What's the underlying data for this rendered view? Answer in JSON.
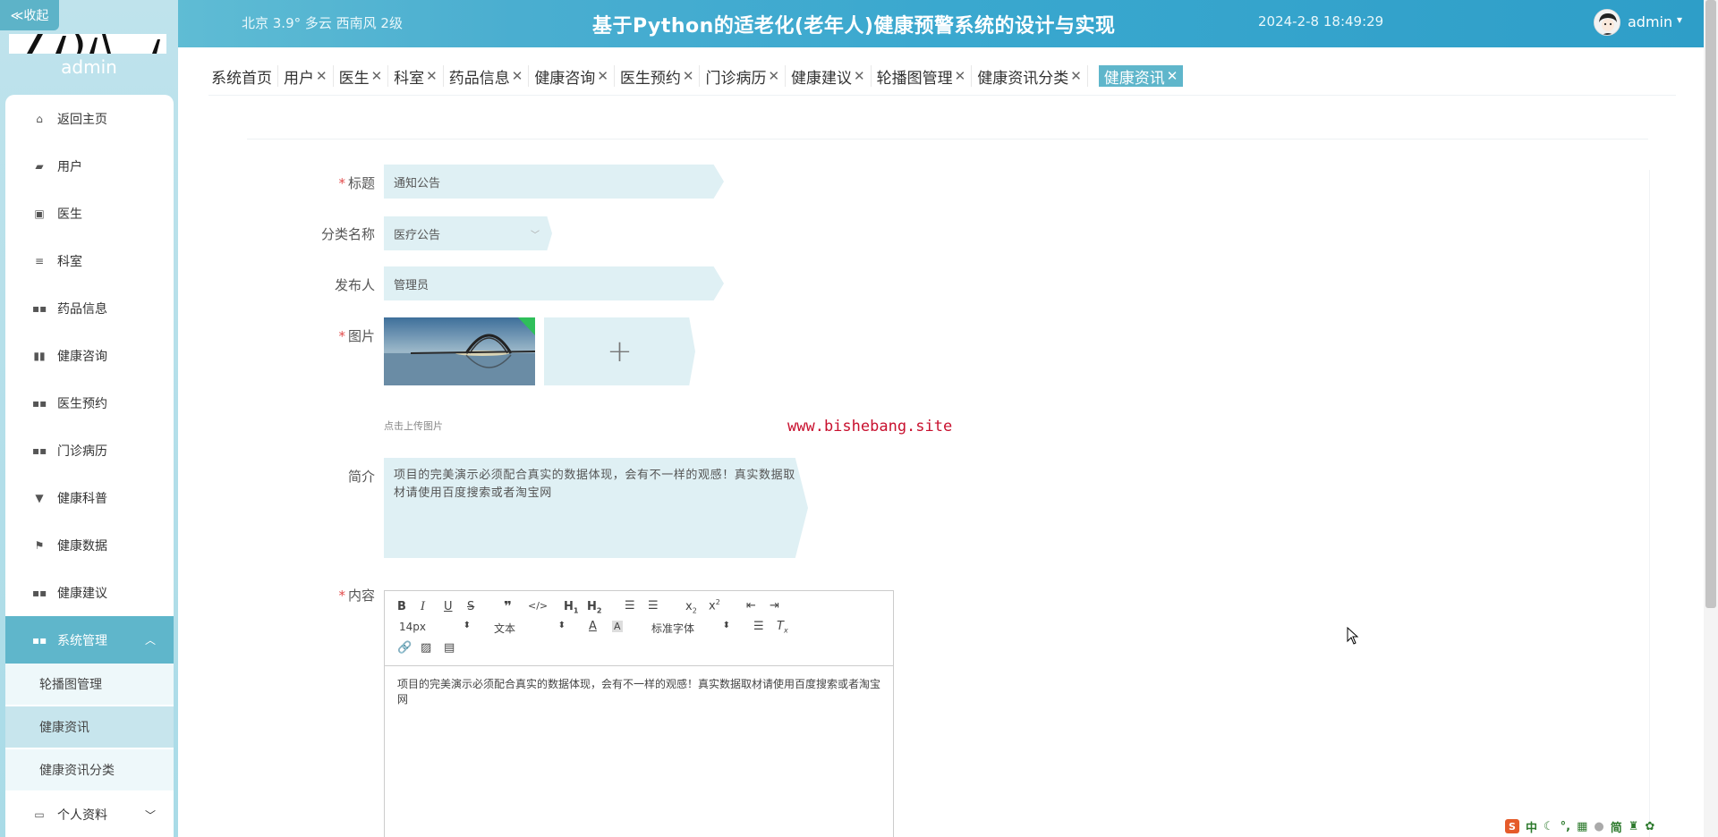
{
  "header": {
    "weather": "北京  3.9°  多云  西南风  2级",
    "title": "基于Python的适老化(老年人)健康预警系统的设计与实现",
    "datetime": "2024-2-8 18:49:29",
    "username": "admin"
  },
  "sidebar": {
    "collapse_label": "≪收起",
    "admin_label": "admin",
    "items": [
      {
        "label": "返回主页",
        "icon": "home-icon"
      },
      {
        "label": "用户",
        "icon": "user-icon"
      },
      {
        "label": "医生",
        "icon": "doctor-icon"
      },
      {
        "label": "科室",
        "icon": "list-icon"
      },
      {
        "label": "药品信息",
        "icon": "grid-icon"
      },
      {
        "label": "健康咨询",
        "icon": "chart-icon"
      },
      {
        "label": "医生预约",
        "icon": "grid-icon"
      },
      {
        "label": "门诊病历",
        "icon": "grid-icon"
      },
      {
        "label": "健康科普",
        "icon": "pin-icon"
      },
      {
        "label": "健康数据",
        "icon": "flag-icon"
      },
      {
        "label": "健康建议",
        "icon": "grid-icon"
      },
      {
        "label": "系统管理",
        "icon": "grid-icon"
      }
    ],
    "sub_items": [
      {
        "label": "轮播图管理"
      },
      {
        "label": "健康资讯"
      },
      {
        "label": "健康资讯分类"
      }
    ],
    "profile": {
      "label": "个人资料",
      "icon": "calendar-icon"
    }
  },
  "tabs": [
    {
      "label": "系统首页",
      "closable": false
    },
    {
      "label": "用户",
      "closable": true
    },
    {
      "label": "医生",
      "closable": true
    },
    {
      "label": "科室",
      "closable": true
    },
    {
      "label": "药品信息",
      "closable": true
    },
    {
      "label": "健康咨询",
      "closable": true
    },
    {
      "label": "医生预约",
      "closable": true
    },
    {
      "label": "门诊病历",
      "closable": true
    },
    {
      "label": "健康建议",
      "closable": true
    },
    {
      "label": "轮播图管理",
      "closable": true
    },
    {
      "label": "健康资讯分类",
      "closable": true
    },
    {
      "label": "健康资讯",
      "closable": true
    }
  ],
  "tab_close_glyph": "✕",
  "form": {
    "title_label": "标题",
    "title_value": "通知公告",
    "category_label": "分类名称",
    "category_value": "医疗公告",
    "publisher_label": "发布人",
    "publisher_value": "管理员",
    "image_label": "图片",
    "upload_hint": "点击上传图片",
    "intro_label": "简介",
    "intro_value": "项目的完美演示必须配合真实的数据体现，会有不一样的观感！真实数据取材请使用百度搜索或者淘宝网",
    "content_label": "内容",
    "required_mark": "*"
  },
  "watermark": "www.bishebang.site",
  "editor": {
    "font_size": "14px",
    "block_type": "文本",
    "font_family": "标准字体",
    "body": "项目的完美演示必须配合真实的数据体现，会有不一样的观感！真实数据取材请使用百度搜索或者淘宝网"
  },
  "ime": {
    "mode": "中",
    "simplified": "简"
  },
  "colors": {
    "accent": "#5fb6cb",
    "required": "#e24b4b",
    "watermark": "#c8102e"
  }
}
